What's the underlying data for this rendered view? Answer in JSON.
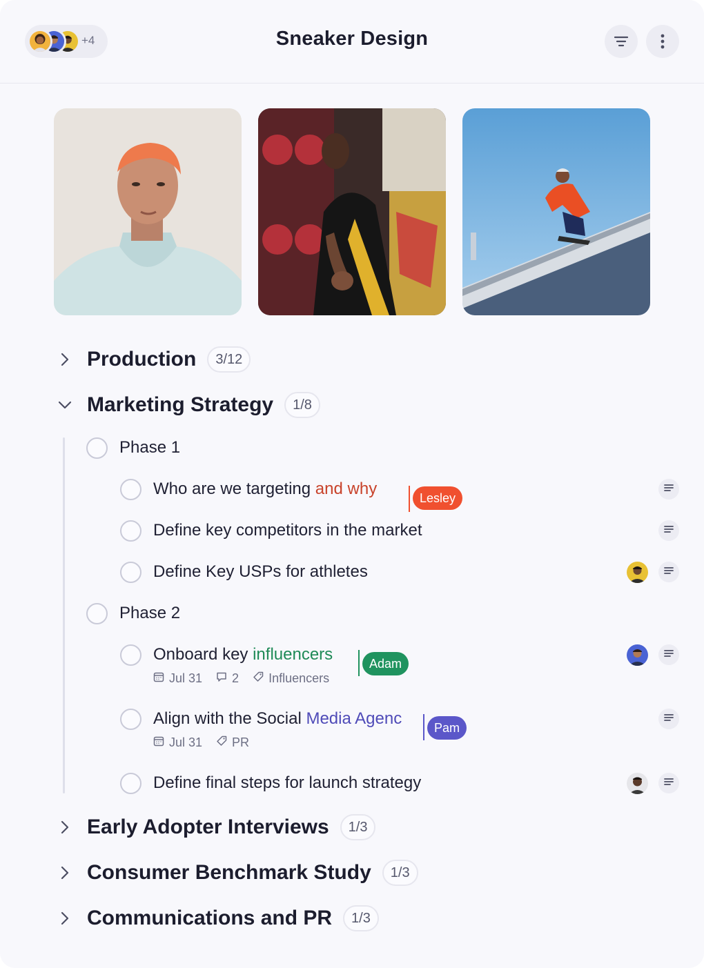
{
  "header": {
    "title": "Sneaker Design",
    "extra_members": "+4"
  },
  "gallery": [
    {
      "subject": "portrait-orange-hair"
    },
    {
      "subject": "person-reaching-graffiti"
    },
    {
      "subject": "skater-crouching-roof"
    }
  ],
  "sections": [
    {
      "title": "Production",
      "count": "3/12",
      "expanded": false
    },
    {
      "title": "Marketing Strategy",
      "count": "1/8",
      "expanded": true
    },
    {
      "title": "Early Adopter Interviews",
      "count": "1/3",
      "expanded": false
    },
    {
      "title": "Consumer Benchmark Study",
      "count": "1/3",
      "expanded": false
    },
    {
      "title": "Communications and PR",
      "count": "1/3",
      "expanded": false
    }
  ],
  "phases": [
    {
      "title": "Phase 1"
    },
    {
      "title": "Phase 2"
    }
  ],
  "tasks": [
    {
      "text": "Who are we targeting ",
      "highlight": "and why",
      "cursor": "Lesley",
      "color": "#f0502f"
    },
    {
      "text": "Define key competitors in the market"
    },
    {
      "text": "Define Key USPs for athletes"
    },
    {
      "text": "Onboard key ",
      "highlight": "influencers",
      "cursor": "Adam",
      "color": "#20935f",
      "date": "Jul 31",
      "comments": "2",
      "tag": "Influencers"
    },
    {
      "text": "Align with the Social ",
      "highlight": "Media Agenc",
      "cursor": "Pam",
      "color": "#5b57c9",
      "date": "Jul 31",
      "tag": "PR"
    },
    {
      "text": "Define final steps for launch strategy"
    }
  ],
  "icons": {
    "filter": "filter-icon",
    "more": "more-vertical-icon",
    "expand": "chevron-right-icon",
    "collapse": "chevron-down-icon",
    "details": "text-lines-icon",
    "calendar": "calendar-icon",
    "comment": "comment-icon",
    "tag": "tag-icon"
  }
}
